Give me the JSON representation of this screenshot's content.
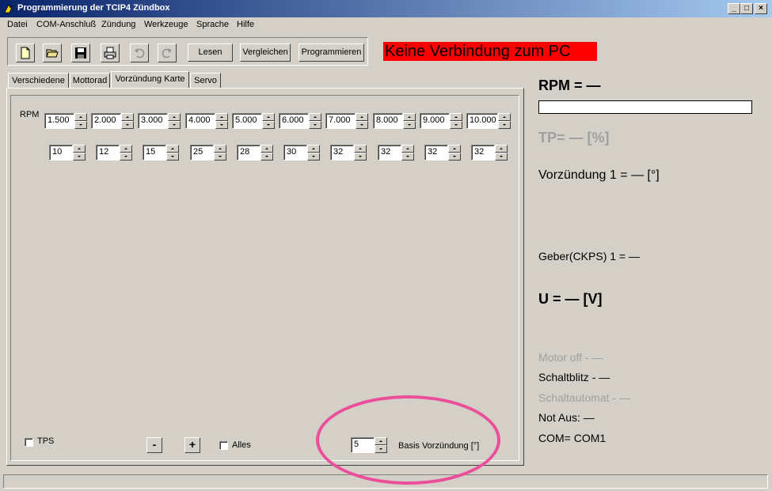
{
  "window": {
    "title": "Programmierung der TCIP4 Zündbox"
  },
  "menu": [
    "Datei",
    "COM-Anschluß",
    "Zündung",
    "Werkzeuge",
    "Sprache",
    "Hilfe"
  ],
  "toolbar": {
    "read_label": "Lesen",
    "compare_label": "Vergleichen",
    "program_label": "Programmieren"
  },
  "status_banner": {
    "text": "Keine Verbindung zum PC",
    "color": "#ff0000"
  },
  "tabs": [
    "Verschiedene",
    "Mottorad",
    "Vorzündung Karte",
    "Servo"
  ],
  "active_tab": "Vorzündung Karte",
  "map": {
    "rpm_label": "RPM",
    "rpm_values": [
      "1.500",
      "2.000",
      "3.000",
      "4.000",
      "5.000",
      "6.000",
      "7.000",
      "8.000",
      "9.000",
      "10.000"
    ],
    "advance_values": [
      "10",
      "12",
      "15",
      "25",
      "28",
      "30",
      "32",
      "32",
      "32",
      "32"
    ]
  },
  "controls": {
    "tps_label": "TPS",
    "minus_label": "-",
    "plus_label": "+",
    "alles_label": "Alles",
    "base_value": "5",
    "base_label": "Basis Vorzündung [°]"
  },
  "readouts": {
    "rpm": "RPM = —",
    "tp": "TP= — [%]",
    "advance": "Vorzündung 1 = — [°]",
    "sensor": "Geber(CKPS) 1 = —",
    "voltage": "U = — [V]",
    "motor_off": "Motor off - —",
    "schaltblitz": "Schaltblitz - —",
    "schaltautomat": "Schaltautomat - —",
    "not_aus": "Not Aus: —",
    "com": "COM= COM1"
  },
  "icons": [
    "new-file-icon",
    "open-folder-icon",
    "save-icon",
    "print-icon",
    "undo-icon",
    "redo-icon"
  ],
  "annotation_color": "#ec4f9a"
}
